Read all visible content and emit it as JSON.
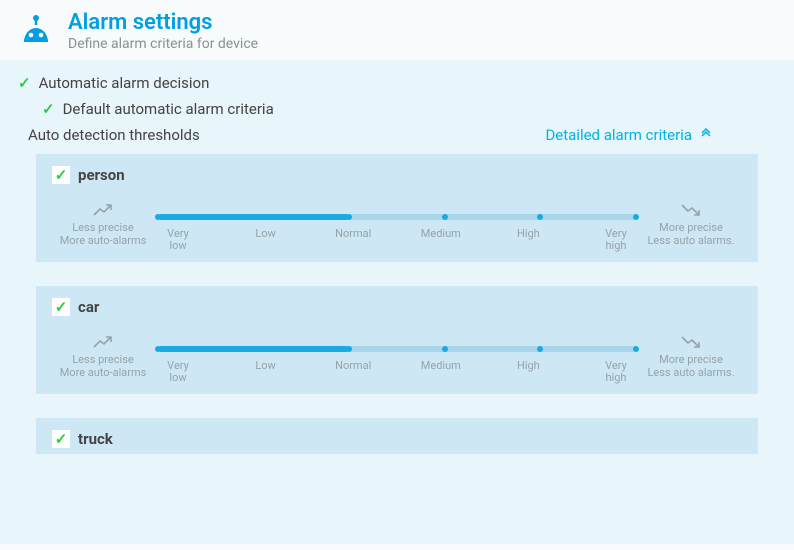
{
  "header": {
    "title": "Alarm settings",
    "subtitle": "Define alarm criteria for device"
  },
  "topChecks": {
    "automatic": "Automatic alarm decision",
    "defaultCriteria": "Default automatic alarm criteria"
  },
  "detail": {
    "sectionLabel": "Auto detection thresholds",
    "linkLabel": "Detailed alarm criteria"
  },
  "endcap": {
    "left1": "Less precise",
    "left2": "More auto-alarms",
    "right1": "More precise",
    "right2": "Less auto alarms."
  },
  "ticks": {
    "t0a": "Very",
    "t0b": "low",
    "t1": "Low",
    "t2": "Normal",
    "t3": "Medium",
    "t4": "High",
    "t5a": "Very",
    "t5b": "high"
  },
  "categories": [
    {
      "name": "person"
    },
    {
      "name": "car"
    },
    {
      "name": "truck"
    }
  ]
}
